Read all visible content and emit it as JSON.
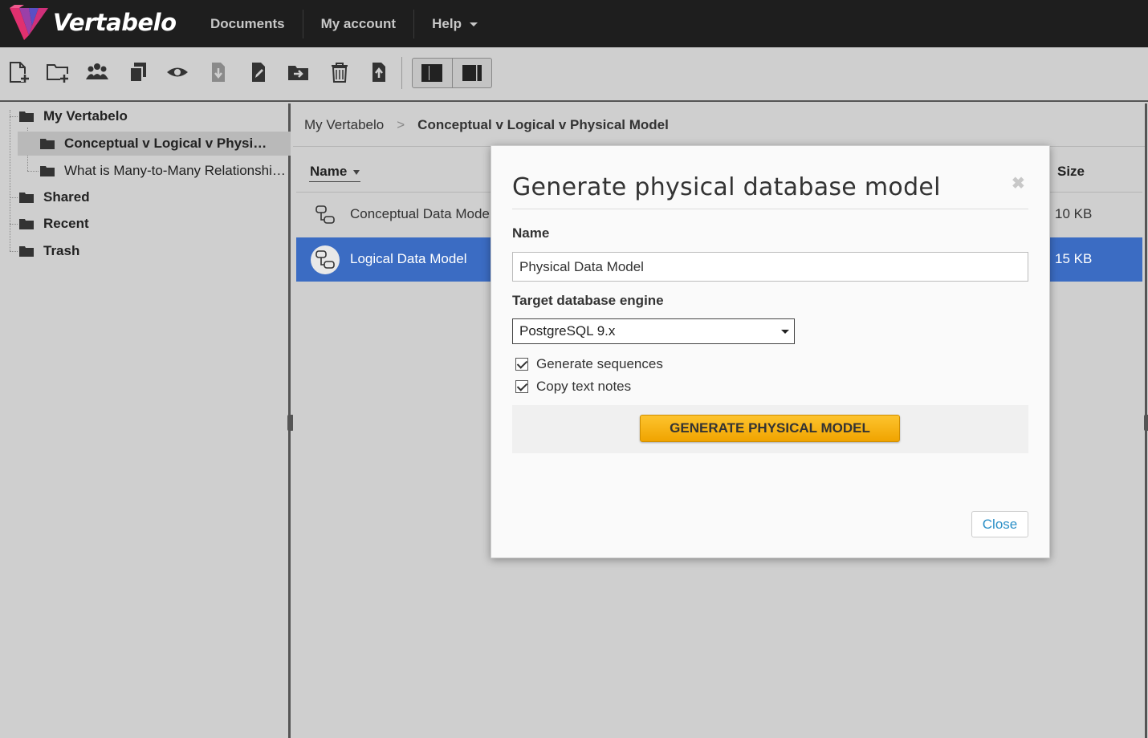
{
  "app": {
    "brand": "Vertabelo"
  },
  "nav": {
    "items": [
      {
        "label": "Documents"
      },
      {
        "label": "My account"
      },
      {
        "label": "Help"
      }
    ]
  },
  "toolbar": {
    "icons": [
      "new-document-icon",
      "new-folder-icon",
      "share-users-icon",
      "copy-icon",
      "preview-icon",
      "download-icon",
      "edit-icon",
      "move-icon",
      "delete-icon",
      "upload-icon"
    ],
    "view_toggle": [
      "left-panel-view-icon",
      "right-panel-view-icon"
    ]
  },
  "sidebar": {
    "items": [
      {
        "label": "My Vertabelo",
        "icon": "folder-icon"
      },
      {
        "label": "Conceptual v Logical v Physi…",
        "icon": "folder-icon"
      },
      {
        "label": "What is Many-to-Many Relationshi…",
        "icon": "folder-icon"
      },
      {
        "label": "Shared",
        "icon": "folder-icon"
      },
      {
        "label": "Recent",
        "icon": "folder-icon"
      },
      {
        "label": "Trash",
        "icon": "folder-icon"
      }
    ]
  },
  "main": {
    "breadcrumb": {
      "root": "My Vertabelo",
      "separator": ">",
      "current": "Conceptual v Logical v Physical Model"
    },
    "columns": {
      "name": "Name",
      "size": "Size"
    },
    "rows": [
      {
        "name": "Conceptual Data Model",
        "size": "10 KB",
        "icon": "model-icon"
      },
      {
        "name": "Logical Data Model",
        "size": "15 KB",
        "icon": "model-icon"
      }
    ]
  },
  "modal": {
    "title": "Generate physical database model",
    "close_x": "✖",
    "name_label": "Name",
    "name_value": "Physical Data Model",
    "engine_label": "Target database engine",
    "engine_value": "PostgreSQL 9.x",
    "generate_sequences": "Generate sequences",
    "copy_text_notes": "Copy text notes",
    "generate_button": "GENERATE PHYSICAL MODEL",
    "close_button": "Close"
  },
  "colors": {
    "topbar": "#1e1e1e",
    "selected_row": "#3b6cc3",
    "primary_button": "#f6b400",
    "link": "#2a8fc7"
  }
}
